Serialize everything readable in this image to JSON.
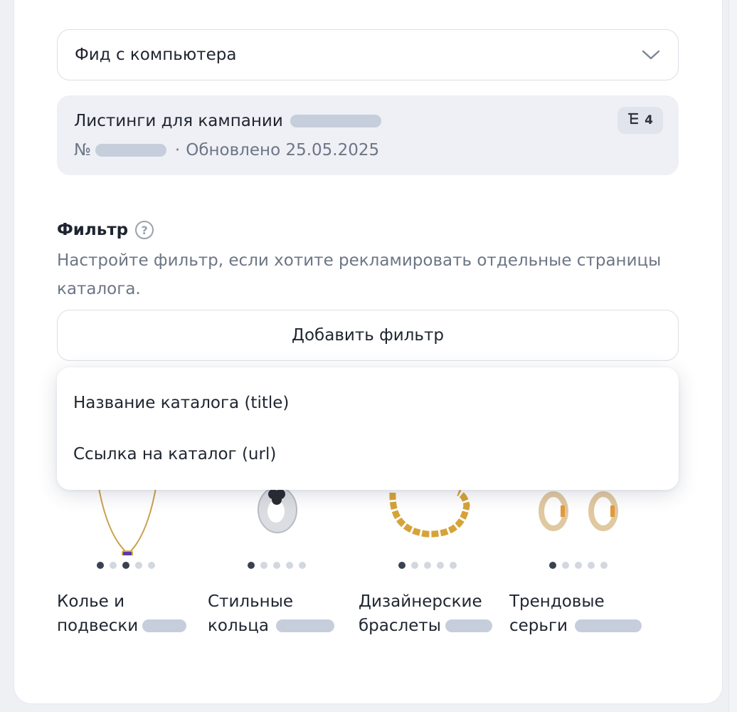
{
  "feed_select": {
    "value": "Фид с компьютера"
  },
  "listing": {
    "title": "Листинги для кампании",
    "number_prefix": "№",
    "separator": "·",
    "updated": "Обновлено 25.05.2025",
    "badge_count": "4"
  },
  "filter": {
    "label": "Фильтр",
    "help_glyph": "?",
    "description": "Настройте фильтр, если хотите рекламировать отдельные страницы каталога.",
    "add_button": "Добавить фильтр",
    "options": [
      "Название каталога (title)",
      "Ссылка на каталог (url)"
    ]
  },
  "products": [
    {
      "line1": "Колье и",
      "line2": "подвески",
      "image": "necklace-pendant"
    },
    {
      "line1": "Стильные",
      "line2": "кольца",
      "image": "ring"
    },
    {
      "line1": "Дизайнерские",
      "line2": "браслеты",
      "image": "bracelet"
    },
    {
      "line1": "Трендовые",
      "line2": "серьги",
      "image": "earrings"
    }
  ],
  "icons": [
    "chevron-down-icon",
    "tree-structure-icon",
    "help-icon"
  ]
}
